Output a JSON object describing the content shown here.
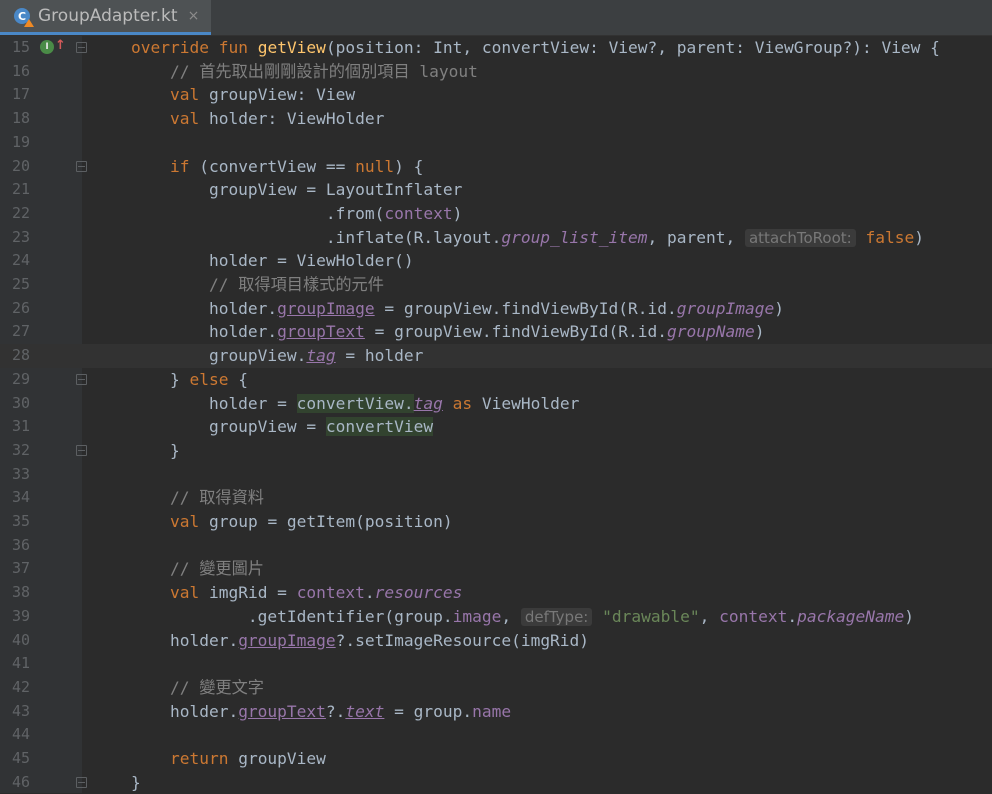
{
  "tab": {
    "title": "GroupAdapter.kt",
    "close_glyph": "×",
    "icon_letter": "C"
  },
  "editor": {
    "current_line": 28,
    "override_marker": "I",
    "lines": [
      {
        "n": "15",
        "fold": "open",
        "marker": true,
        "tokens": [
          [
            "    ",
            "plain"
          ],
          [
            "override",
            " kw"
          ],
          [
            " ",
            "plain"
          ],
          [
            "fun",
            "kw"
          ],
          [
            " ",
            "plain"
          ],
          [
            "getView",
            "fn"
          ],
          [
            "(position: Int, convertView: View?, parent: ViewGroup?): View {",
            "plain"
          ]
        ]
      },
      {
        "n": "16",
        "tokens": [
          [
            "        ",
            "plain"
          ],
          [
            "// 首先取出剛剛設計的個別項目 layout",
            "cm"
          ]
        ]
      },
      {
        "n": "17",
        "tokens": [
          [
            "        ",
            "plain"
          ],
          [
            "val",
            "kw"
          ],
          [
            " groupView: View",
            "plain"
          ]
        ]
      },
      {
        "n": "18",
        "tokens": [
          [
            "        ",
            "plain"
          ],
          [
            "val",
            "kw"
          ],
          [
            " holder: ViewHolder",
            "plain"
          ]
        ]
      },
      {
        "n": "19",
        "tokens": []
      },
      {
        "n": "20",
        "fold": "open",
        "tokens": [
          [
            "        ",
            "plain"
          ],
          [
            "if",
            "kw"
          ],
          [
            " (convertView == ",
            "plain"
          ],
          [
            "null",
            "kw"
          ],
          [
            ") {",
            "plain"
          ]
        ]
      },
      {
        "n": "21",
        "tokens": [
          [
            "            groupView = LayoutInflater",
            "plain"
          ]
        ]
      },
      {
        "n": "22",
        "tokens": [
          [
            "                        .from(",
            "plain"
          ],
          [
            "context",
            "prop"
          ],
          [
            ")",
            "plain"
          ]
        ]
      },
      {
        "n": "23",
        "tokens": [
          [
            "                        .inflate(R.layout.",
            "plain"
          ],
          [
            "group_list_item",
            "propi"
          ],
          [
            ", parent, ",
            "plain"
          ],
          [
            "attachToRoot:",
            "hint"
          ],
          [
            " ",
            "plain"
          ],
          [
            "false",
            "kw"
          ],
          [
            ")",
            "plain"
          ]
        ]
      },
      {
        "n": "24",
        "tokens": [
          [
            "            holder = ViewHolder()",
            "plain"
          ]
        ]
      },
      {
        "n": "25",
        "tokens": [
          [
            "            ",
            "plain"
          ],
          [
            "// 取得項目樣式的元件",
            "cm"
          ]
        ]
      },
      {
        "n": "26",
        "tokens": [
          [
            "            holder.",
            "plain"
          ],
          [
            "groupImage",
            "propu"
          ],
          [
            " = groupView.findViewById(R.id.",
            "plain"
          ],
          [
            "groupImage",
            "propi"
          ],
          [
            ")",
            "plain"
          ]
        ]
      },
      {
        "n": "27",
        "tokens": [
          [
            "            holder.",
            "plain"
          ],
          [
            "groupText",
            "propu"
          ],
          [
            " = groupView.findViewById(R.id.",
            "plain"
          ],
          [
            "groupName",
            "propi"
          ],
          [
            ")",
            "plain"
          ]
        ]
      },
      {
        "n": "28",
        "tokens": [
          [
            "            groupView.",
            "plain"
          ],
          [
            "tag",
            "propiu"
          ],
          [
            " = holder",
            "plain"
          ]
        ]
      },
      {
        "n": "29",
        "fold": "open",
        "tokens": [
          [
            "        } ",
            "plain"
          ],
          [
            "else",
            "kw"
          ],
          [
            " {",
            "plain"
          ]
        ]
      },
      {
        "n": "30",
        "tokens": [
          [
            "            holder = ",
            "plain"
          ],
          [
            "convertView.",
            "hl"
          ],
          [
            "tag",
            "propiu"
          ],
          [
            " ",
            "plain"
          ],
          [
            "as",
            "kw"
          ],
          [
            " ViewHolder",
            "plain"
          ]
        ]
      },
      {
        "n": "31",
        "tokens": [
          [
            "            groupView = ",
            "plain"
          ],
          [
            "convertView",
            "hl"
          ]
        ]
      },
      {
        "n": "32",
        "fold": "close",
        "tokens": [
          [
            "        }",
            "plain"
          ]
        ]
      },
      {
        "n": "33",
        "tokens": []
      },
      {
        "n": "34",
        "tokens": [
          [
            "        ",
            "plain"
          ],
          [
            "// 取得資料",
            "cm"
          ]
        ]
      },
      {
        "n": "35",
        "tokens": [
          [
            "        ",
            "plain"
          ],
          [
            "val",
            "kw"
          ],
          [
            " group = getItem(position)",
            "plain"
          ]
        ]
      },
      {
        "n": "36",
        "tokens": []
      },
      {
        "n": "37",
        "tokens": [
          [
            "        ",
            "plain"
          ],
          [
            "// 變更圖片",
            "cm"
          ]
        ]
      },
      {
        "n": "38",
        "tokens": [
          [
            "        ",
            "plain"
          ],
          [
            "val",
            "kw"
          ],
          [
            " imgRid = ",
            "plain"
          ],
          [
            "context",
            "prop"
          ],
          [
            ".",
            "plain"
          ],
          [
            "resources",
            "propi"
          ]
        ]
      },
      {
        "n": "39",
        "tokens": [
          [
            "                .getIdentifier(group.",
            "plain"
          ],
          [
            "image",
            "prop"
          ],
          [
            ", ",
            "plain"
          ],
          [
            "defType:",
            "hint"
          ],
          [
            " ",
            "plain"
          ],
          [
            "\"drawable\"",
            "str"
          ],
          [
            ", ",
            "plain"
          ],
          [
            "context",
            "prop"
          ],
          [
            ".",
            "plain"
          ],
          [
            "packageName",
            "propi"
          ],
          [
            ")",
            "plain"
          ]
        ]
      },
      {
        "n": "40",
        "tokens": [
          [
            "        holder.",
            "plain"
          ],
          [
            "groupImage",
            "propu"
          ],
          [
            "?.setImageResource(imgRid)",
            "plain"
          ]
        ]
      },
      {
        "n": "41",
        "tokens": []
      },
      {
        "n": "42",
        "tokens": [
          [
            "        ",
            "plain"
          ],
          [
            "// 變更文字",
            "cm"
          ]
        ]
      },
      {
        "n": "43",
        "tokens": [
          [
            "        holder.",
            "plain"
          ],
          [
            "groupText",
            "propu"
          ],
          [
            "?.",
            "plain"
          ],
          [
            "text",
            "propiu"
          ],
          [
            " = group.",
            "plain"
          ],
          [
            "name",
            "prop"
          ]
        ]
      },
      {
        "n": "44",
        "tokens": []
      },
      {
        "n": "45",
        "tokens": [
          [
            "        ",
            "plain"
          ],
          [
            "return",
            "kw"
          ],
          [
            " groupView",
            "plain"
          ]
        ]
      },
      {
        "n": "46",
        "fold": "close",
        "tokens": [
          [
            "    }",
            "plain"
          ]
        ]
      }
    ]
  }
}
